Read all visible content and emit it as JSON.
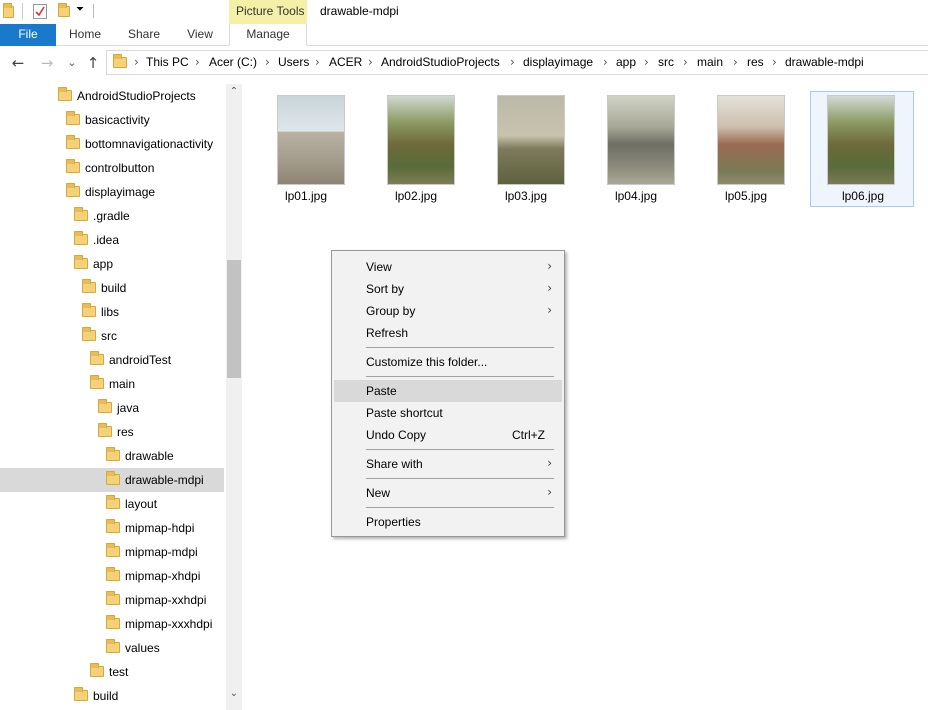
{
  "window": {
    "title": "drawable-mdpi",
    "context_tab_group": "Picture Tools"
  },
  "ribbon": {
    "tabs": [
      "File",
      "Home",
      "Share",
      "View",
      "Manage"
    ]
  },
  "nav": {
    "back": "←",
    "forward": "→",
    "recent": "⌄",
    "up": "↑"
  },
  "address": {
    "separator": "›",
    "crumbs": [
      "This PC",
      "Acer (C:)",
      "Users",
      "ACER",
      "AndroidStudioProjects",
      "displayimage",
      "app",
      "src",
      "main",
      "res",
      "drawable-mdpi"
    ]
  },
  "tree": {
    "items": [
      {
        "label": "AndroidStudioProjects"
      },
      {
        "label": "basicactivity"
      },
      {
        "label": "bottomnavigationactivity"
      },
      {
        "label": "controlbutton"
      },
      {
        "label": "displayimage"
      },
      {
        "label": ".gradle"
      },
      {
        "label": ".idea"
      },
      {
        "label": "app"
      },
      {
        "label": "build"
      },
      {
        "label": "libs"
      },
      {
        "label": "src"
      },
      {
        "label": "androidTest"
      },
      {
        "label": "main"
      },
      {
        "label": "java"
      },
      {
        "label": "res"
      },
      {
        "label": "drawable"
      },
      {
        "label": "drawable-mdpi",
        "selected": true
      },
      {
        "label": "layout"
      },
      {
        "label": "mipmap-hdpi"
      },
      {
        "label": "mipmap-mdpi"
      },
      {
        "label": "mipmap-xhdpi"
      },
      {
        "label": "mipmap-xxhdpi"
      },
      {
        "label": "mipmap-xxxhdpi"
      },
      {
        "label": "values"
      },
      {
        "label": "test"
      },
      {
        "label": "build"
      }
    ],
    "scroll_up": "⌃",
    "scroll_down": "⌄"
  },
  "files": [
    {
      "name": "lp01.jpg"
    },
    {
      "name": "lp02.jpg"
    },
    {
      "name": "lp03.jpg"
    },
    {
      "name": "lp04.jpg"
    },
    {
      "name": "lp05.jpg"
    },
    {
      "name": "lp06.jpg",
      "selected": true
    }
  ],
  "context_menu": {
    "items": [
      {
        "label": "View",
        "submenu": true
      },
      {
        "label": "Sort by",
        "submenu": true
      },
      {
        "label": "Group by",
        "submenu": true
      },
      {
        "label": "Refresh"
      },
      {
        "label": "Customize this folder..."
      },
      {
        "label": "Paste",
        "highlighted": true
      },
      {
        "label": "Paste shortcut"
      },
      {
        "label": "Undo Copy",
        "shortcut": "Ctrl+Z"
      },
      {
        "label": "Share with",
        "submenu": true
      },
      {
        "label": "New",
        "submenu": true
      },
      {
        "label": "Properties"
      }
    ],
    "submenu_arrow": "›"
  },
  "colors": {
    "file_tab": "#1979ca",
    "context_tab": "#f5f0a8",
    "selection": "#d9d9d9",
    "folder": "#f5d27a"
  }
}
